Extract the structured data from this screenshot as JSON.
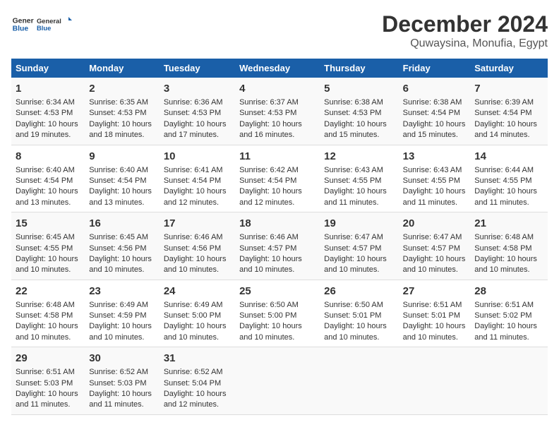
{
  "logo": {
    "line1": "General",
    "line2": "Blue"
  },
  "title": "December 2024",
  "subtitle": "Quwaysina, Monufia, Egypt",
  "days_of_week": [
    "Sunday",
    "Monday",
    "Tuesday",
    "Wednesday",
    "Thursday",
    "Friday",
    "Saturday"
  ],
  "weeks": [
    [
      {
        "day": "1",
        "sunrise": "Sunrise: 6:34 AM",
        "sunset": "Sunset: 4:53 PM",
        "daylight": "Daylight: 10 hours and 19 minutes."
      },
      {
        "day": "2",
        "sunrise": "Sunrise: 6:35 AM",
        "sunset": "Sunset: 4:53 PM",
        "daylight": "Daylight: 10 hours and 18 minutes."
      },
      {
        "day": "3",
        "sunrise": "Sunrise: 6:36 AM",
        "sunset": "Sunset: 4:53 PM",
        "daylight": "Daylight: 10 hours and 17 minutes."
      },
      {
        "day": "4",
        "sunrise": "Sunrise: 6:37 AM",
        "sunset": "Sunset: 4:53 PM",
        "daylight": "Daylight: 10 hours and 16 minutes."
      },
      {
        "day": "5",
        "sunrise": "Sunrise: 6:38 AM",
        "sunset": "Sunset: 4:53 PM",
        "daylight": "Daylight: 10 hours and 15 minutes."
      },
      {
        "day": "6",
        "sunrise": "Sunrise: 6:38 AM",
        "sunset": "Sunset: 4:54 PM",
        "daylight": "Daylight: 10 hours and 15 minutes."
      },
      {
        "day": "7",
        "sunrise": "Sunrise: 6:39 AM",
        "sunset": "Sunset: 4:54 PM",
        "daylight": "Daylight: 10 hours and 14 minutes."
      }
    ],
    [
      {
        "day": "8",
        "sunrise": "Sunrise: 6:40 AM",
        "sunset": "Sunset: 4:54 PM",
        "daylight": "Daylight: 10 hours and 13 minutes."
      },
      {
        "day": "9",
        "sunrise": "Sunrise: 6:40 AM",
        "sunset": "Sunset: 4:54 PM",
        "daylight": "Daylight: 10 hours and 13 minutes."
      },
      {
        "day": "10",
        "sunrise": "Sunrise: 6:41 AM",
        "sunset": "Sunset: 4:54 PM",
        "daylight": "Daylight: 10 hours and 12 minutes."
      },
      {
        "day": "11",
        "sunrise": "Sunrise: 6:42 AM",
        "sunset": "Sunset: 4:54 PM",
        "daylight": "Daylight: 10 hours and 12 minutes."
      },
      {
        "day": "12",
        "sunrise": "Sunrise: 6:43 AM",
        "sunset": "Sunset: 4:55 PM",
        "daylight": "Daylight: 10 hours and 11 minutes."
      },
      {
        "day": "13",
        "sunrise": "Sunrise: 6:43 AM",
        "sunset": "Sunset: 4:55 PM",
        "daylight": "Daylight: 10 hours and 11 minutes."
      },
      {
        "day": "14",
        "sunrise": "Sunrise: 6:44 AM",
        "sunset": "Sunset: 4:55 PM",
        "daylight": "Daylight: 10 hours and 11 minutes."
      }
    ],
    [
      {
        "day": "15",
        "sunrise": "Sunrise: 6:45 AM",
        "sunset": "Sunset: 4:55 PM",
        "daylight": "Daylight: 10 hours and 10 minutes."
      },
      {
        "day": "16",
        "sunrise": "Sunrise: 6:45 AM",
        "sunset": "Sunset: 4:56 PM",
        "daylight": "Daylight: 10 hours and 10 minutes."
      },
      {
        "day": "17",
        "sunrise": "Sunrise: 6:46 AM",
        "sunset": "Sunset: 4:56 PM",
        "daylight": "Daylight: 10 hours and 10 minutes."
      },
      {
        "day": "18",
        "sunrise": "Sunrise: 6:46 AM",
        "sunset": "Sunset: 4:57 PM",
        "daylight": "Daylight: 10 hours and 10 minutes."
      },
      {
        "day": "19",
        "sunrise": "Sunrise: 6:47 AM",
        "sunset": "Sunset: 4:57 PM",
        "daylight": "Daylight: 10 hours and 10 minutes."
      },
      {
        "day": "20",
        "sunrise": "Sunrise: 6:47 AM",
        "sunset": "Sunset: 4:57 PM",
        "daylight": "Daylight: 10 hours and 10 minutes."
      },
      {
        "day": "21",
        "sunrise": "Sunrise: 6:48 AM",
        "sunset": "Sunset: 4:58 PM",
        "daylight": "Daylight: 10 hours and 10 minutes."
      }
    ],
    [
      {
        "day": "22",
        "sunrise": "Sunrise: 6:48 AM",
        "sunset": "Sunset: 4:58 PM",
        "daylight": "Daylight: 10 hours and 10 minutes."
      },
      {
        "day": "23",
        "sunrise": "Sunrise: 6:49 AM",
        "sunset": "Sunset: 4:59 PM",
        "daylight": "Daylight: 10 hours and 10 minutes."
      },
      {
        "day": "24",
        "sunrise": "Sunrise: 6:49 AM",
        "sunset": "Sunset: 5:00 PM",
        "daylight": "Daylight: 10 hours and 10 minutes."
      },
      {
        "day": "25",
        "sunrise": "Sunrise: 6:50 AM",
        "sunset": "Sunset: 5:00 PM",
        "daylight": "Daylight: 10 hours and 10 minutes."
      },
      {
        "day": "26",
        "sunrise": "Sunrise: 6:50 AM",
        "sunset": "Sunset: 5:01 PM",
        "daylight": "Daylight: 10 hours and 10 minutes."
      },
      {
        "day": "27",
        "sunrise": "Sunrise: 6:51 AM",
        "sunset": "Sunset: 5:01 PM",
        "daylight": "Daylight: 10 hours and 10 minutes."
      },
      {
        "day": "28",
        "sunrise": "Sunrise: 6:51 AM",
        "sunset": "Sunset: 5:02 PM",
        "daylight": "Daylight: 10 hours and 11 minutes."
      }
    ],
    [
      {
        "day": "29",
        "sunrise": "Sunrise: 6:51 AM",
        "sunset": "Sunset: 5:03 PM",
        "daylight": "Daylight: 10 hours and 11 minutes."
      },
      {
        "day": "30",
        "sunrise": "Sunrise: 6:52 AM",
        "sunset": "Sunset: 5:03 PM",
        "daylight": "Daylight: 10 hours and 11 minutes."
      },
      {
        "day": "31",
        "sunrise": "Sunrise: 6:52 AM",
        "sunset": "Sunset: 5:04 PM",
        "daylight": "Daylight: 10 hours and 12 minutes."
      },
      null,
      null,
      null,
      null
    ]
  ]
}
